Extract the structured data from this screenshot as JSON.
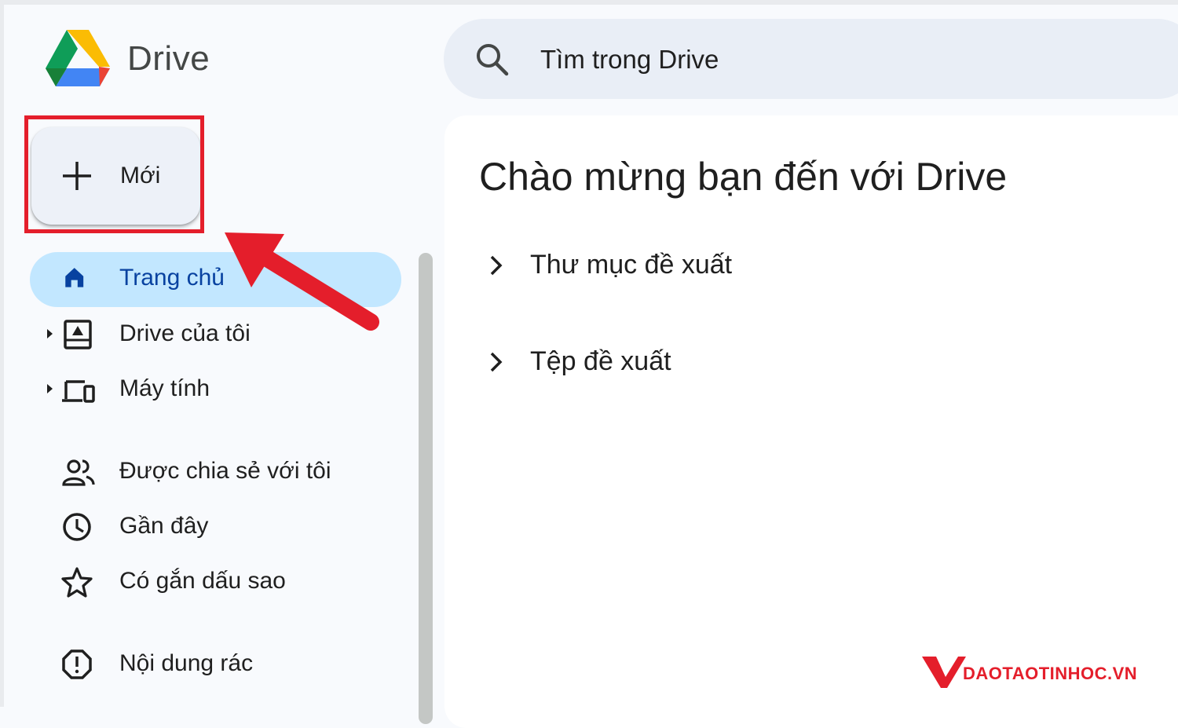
{
  "app": {
    "title": "Drive"
  },
  "search": {
    "placeholder": "Tìm trong Drive"
  },
  "new_button": {
    "label": "Mới"
  },
  "sidebar": {
    "items": [
      {
        "label": "Trang chủ",
        "icon": "home-icon",
        "active": true
      },
      {
        "label": "Drive của tôi",
        "icon": "my-drive-icon",
        "expandable": true
      },
      {
        "label": "Máy tính",
        "icon": "computers-icon",
        "expandable": true
      },
      {
        "label": "Được chia sẻ với tôi",
        "icon": "shared-people-icon"
      },
      {
        "label": "Gần đây",
        "icon": "clock-icon"
      },
      {
        "label": "Có gắn dấu sao",
        "icon": "star-icon"
      },
      {
        "label": "Nội dung rác",
        "icon": "spam-icon"
      }
    ]
  },
  "main": {
    "heading": "Chào mừng bạn đến với Drive",
    "sections": [
      {
        "label": "Thư mục đề xuất"
      },
      {
        "label": "Tệp đề xuất"
      }
    ]
  },
  "watermark": {
    "text": "DAOTAOTINHOC.VN"
  },
  "colors": {
    "highlight_red": "#e41e2b",
    "active_nav_bg": "#c2e7ff",
    "active_nav_text": "#0842a0",
    "search_bg": "#e9eef6",
    "page_bg": "#f8fafd"
  }
}
